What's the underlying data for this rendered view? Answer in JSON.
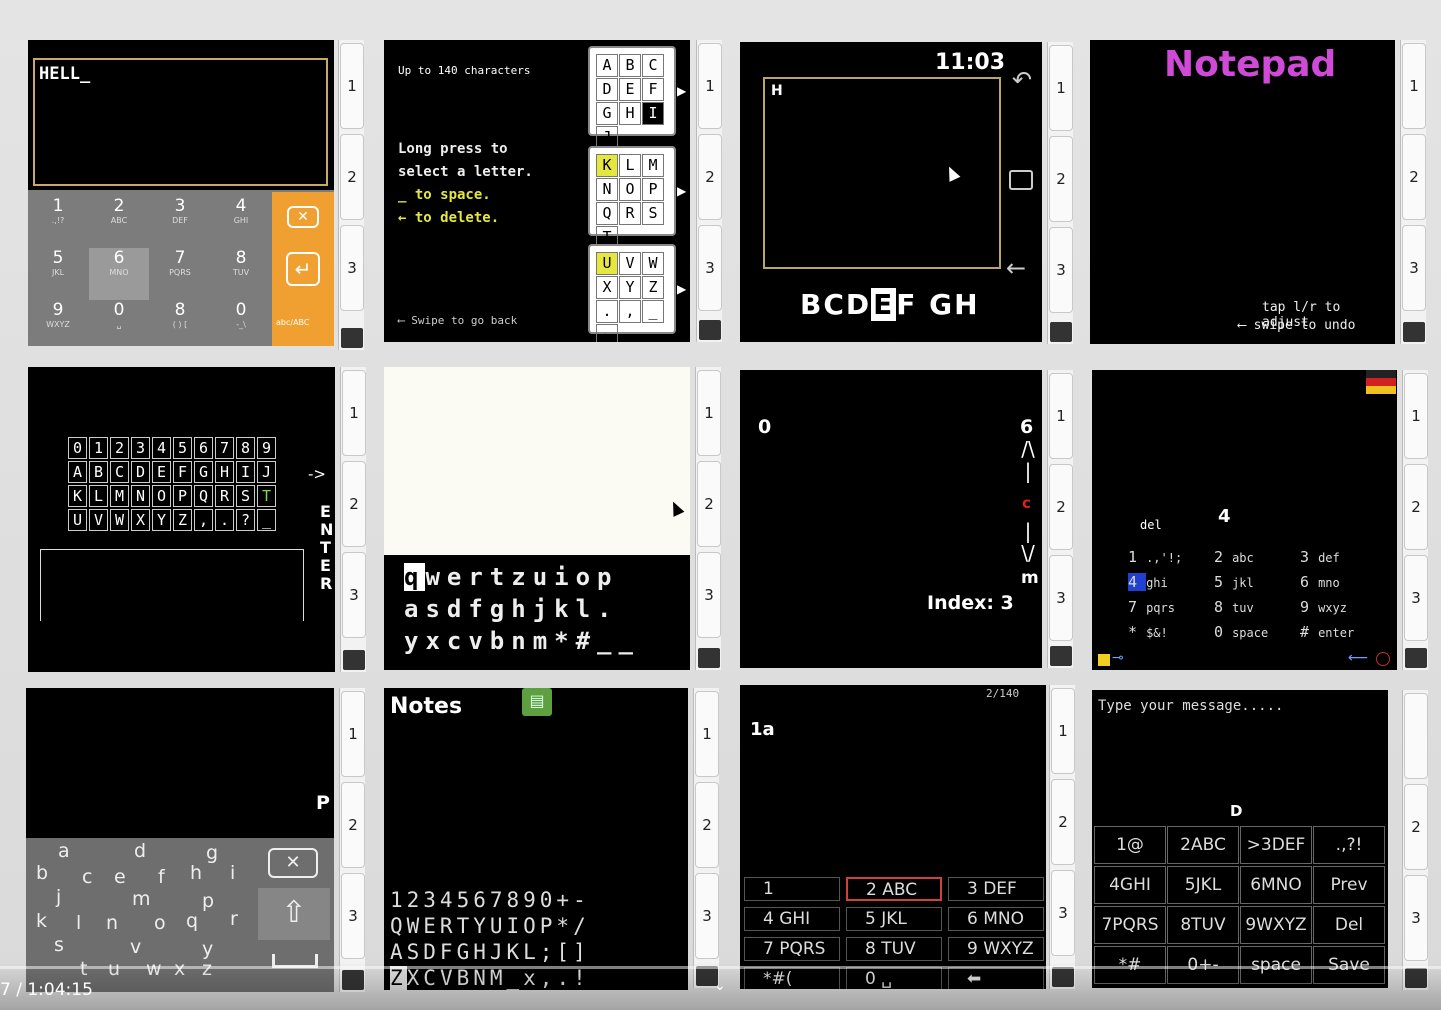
{
  "panel1": {
    "text": "HELL_",
    "keys": [
      {
        "d": "1",
        "l": ".,!?"
      },
      {
        "d": "2",
        "l": "ABC"
      },
      {
        "d": "3",
        "l": "DEF"
      },
      {
        "d": "4",
        "l": "GHI"
      },
      {
        "d": "5",
        "l": "JKL"
      },
      {
        "d": "6",
        "l": "MNO"
      },
      {
        "d": "7",
        "l": "PQRS"
      },
      {
        "d": "8",
        "l": "TUV"
      },
      {
        "d": "9",
        "l": "WXYZ"
      },
      {
        "d": "0",
        "l": "␣"
      },
      {
        "d": "8",
        "l": "( ) ["
      },
      {
        "d": "0",
        "l": "-_\\"
      }
    ],
    "case_label": "abc/ABC",
    "accent": "#f0a030"
  },
  "panel2": {
    "hint": "Up to 140 characters",
    "instructions": [
      "Long press to",
      "select a letter.",
      "_ to space.",
      "← to delete."
    ],
    "swipe": "Swipe to go back",
    "groups": [
      [
        "A",
        "B",
        "C",
        "D",
        "E",
        "F",
        "G",
        "H",
        "I",
        "J"
      ],
      [
        "K",
        "L",
        "M",
        "N",
        "O",
        "P",
        "Q",
        "R",
        "S",
        "T"
      ],
      [
        "U",
        "V",
        "W",
        "X",
        "Y",
        "Z",
        ".",
        ",",
        "_",
        "←"
      ]
    ]
  },
  "panel3": {
    "time": "11:03",
    "text": "H",
    "letters_left": "BCD",
    "letter_sel": "E",
    "letters_right": "F GH"
  },
  "panel4": {
    "title": "Notepad",
    "hint1": "tap l/r to adjust",
    "hint2": "swipe to undo",
    "title_color": "#d04ad8"
  },
  "panel5": {
    "rows": [
      [
        "0",
        "1",
        "2",
        "3",
        "4",
        "5",
        "6",
        "7",
        "8",
        "9"
      ],
      [
        "A",
        "B",
        "C",
        "D",
        "E",
        "F",
        "G",
        "H",
        "I",
        "J"
      ],
      [
        "K",
        "L",
        "M",
        "N",
        "O",
        "P",
        "Q",
        "R",
        "S",
        "T"
      ],
      [
        "U",
        "V",
        "W",
        "X",
        "Y",
        "Z",
        ",",
        ".",
        "?",
        "_"
      ]
    ],
    "arrow": "->",
    "enter": "ENTER"
  },
  "panel6": {
    "rows": [
      "qwertzuiop",
      "asdfghjkl.",
      "yxcvbnm*#__"
    ]
  },
  "panel7": {
    "start": "0",
    "end": "6",
    "current": "c",
    "last": "m",
    "index": "Index: 3"
  },
  "panel8": {
    "del": "del",
    "digit": "4",
    "items": [
      [
        "1",
        ".,'!;"
      ],
      [
        "2",
        "abc"
      ],
      [
        "3",
        "def"
      ],
      [
        "4",
        "ghi"
      ],
      [
        "5",
        "jkl"
      ],
      [
        "6",
        "mno"
      ],
      [
        "7",
        "pqrs"
      ],
      [
        "8",
        "tuv"
      ],
      [
        "9",
        "wxyz"
      ],
      [
        "*",
        "$&!"
      ],
      [
        "0",
        "space"
      ],
      [
        "#",
        "enter"
      ]
    ]
  },
  "panel9": {
    "char": "P",
    "letters": [
      "a",
      "d",
      "g",
      "b",
      "c",
      "e",
      "f",
      "h",
      "i",
      "j",
      "m",
      "p",
      "k",
      "l",
      "n",
      "o",
      "q",
      "r",
      "s",
      "v",
      "y",
      "t",
      "u",
      "w",
      "x",
      "z"
    ]
  },
  "panel10": {
    "title": "Notes",
    "rows": [
      "1234567890+-",
      "QWERTYUIOP*/",
      "ASDFGHJKL;[]",
      "ZXCVBNM_x,.!"
    ]
  },
  "panel11": {
    "counter": "2/140",
    "text": "1a",
    "keys": [
      [
        "1",
        ""
      ],
      [
        "2 ABC",
        ""
      ],
      [
        "3 DEF",
        ""
      ],
      [
        "4 GHI",
        ""
      ],
      [
        "5 JKL",
        ""
      ],
      [
        "6 MNO",
        ""
      ],
      [
        "7 PQRS",
        ""
      ],
      [
        "8 TUV",
        ""
      ],
      [
        "9 WXYZ",
        ""
      ],
      [
        "*#(",
        ""
      ],
      [
        "0 ␣",
        ""
      ],
      [
        "⬅",
        ""
      ]
    ]
  },
  "panel12": {
    "placeholder": "Type your message.....",
    "char": "D",
    "keys": [
      "1@",
      "2ABC",
      ">3DEF",
      ".,?!",
      "4GHI",
      "5JKL",
      "6MNO",
      "Prev",
      "7PQRS",
      "8TUV",
      "9WXYZ",
      "Del",
      "*#",
      "0+-",
      "space",
      "Save"
    ]
  },
  "strip": [
    "1",
    "2",
    "3"
  ],
  "video": {
    "time": "7 / 1:04:15"
  }
}
